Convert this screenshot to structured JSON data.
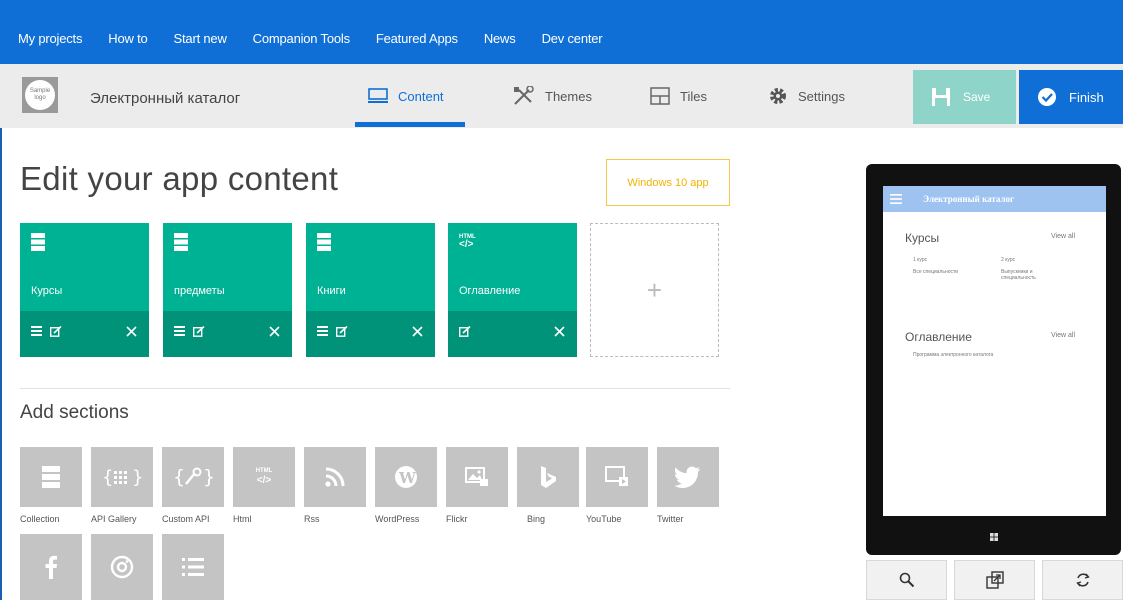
{
  "topnav": {
    "items": [
      "My projects",
      "How to",
      "Start new",
      "Companion Tools",
      "Featured Apps",
      "News",
      "Dev center"
    ]
  },
  "appbar": {
    "logo_text": "Sample logo",
    "app_name": "Электронный каталог",
    "tabs": [
      {
        "label": "Content",
        "icon": "monitor-icon",
        "active": true
      },
      {
        "label": "Themes",
        "icon": "tools-icon",
        "active": false
      },
      {
        "label": "Tiles",
        "icon": "tiles-icon",
        "active": false
      },
      {
        "label": "Settings",
        "icon": "gear-icon",
        "active": false
      }
    ],
    "save_label": "Save",
    "finish_label": "Finish"
  },
  "main": {
    "title": "Edit your app content",
    "windows10_label": "Windows 10 app",
    "tiles": [
      {
        "label": "Курсы",
        "icon": "collection-icon"
      },
      {
        "label": "предметы",
        "icon": "collection-icon"
      },
      {
        "label": "Книги",
        "icon": "collection-icon"
      },
      {
        "label": "Оглавление",
        "icon": "html-icon",
        "icon_text": "HTML"
      }
    ],
    "add_tile_symbol": "+",
    "add_sections_title": "Add sections",
    "sections": [
      {
        "label": "Collection",
        "icon": "collection-icon"
      },
      {
        "label": "API Gallery",
        "icon": "api-gallery-icon"
      },
      {
        "label": "Custom API",
        "icon": "custom-api-icon"
      },
      {
        "label": "Html",
        "icon": "html-icon"
      },
      {
        "label": "Rss",
        "icon": "rss-icon"
      },
      {
        "label": "WordPress",
        "icon": "wordpress-icon"
      },
      {
        "label": "Flickr",
        "icon": "flickr-icon"
      },
      {
        "label": "Bing",
        "icon": "bing-icon"
      },
      {
        "label": "YouTube",
        "icon": "youtube-icon"
      },
      {
        "label": "Twitter",
        "icon": "twitter-icon"
      },
      {
        "label": "",
        "icon": "facebook-icon"
      },
      {
        "label": "",
        "icon": "instagram-icon"
      },
      {
        "label": "",
        "icon": "list-icon"
      }
    ]
  },
  "preview": {
    "app_title": "Электронный каталог",
    "section1_title": "Курсы",
    "section1_viewall": "View all",
    "section1_items": [
      "1 курс",
      "2 курс",
      "Все специальности",
      "Выпускники и специальность"
    ],
    "section2_title": "Оглавление",
    "section2_viewall": "View all",
    "section2_text": "Программа электронного каталога"
  },
  "colors": {
    "brand": "#0f6fd6",
    "tile": "#00b294",
    "tile_bar": "#00937a",
    "save": "#8fd4c8",
    "windows10": "#f0b400"
  }
}
